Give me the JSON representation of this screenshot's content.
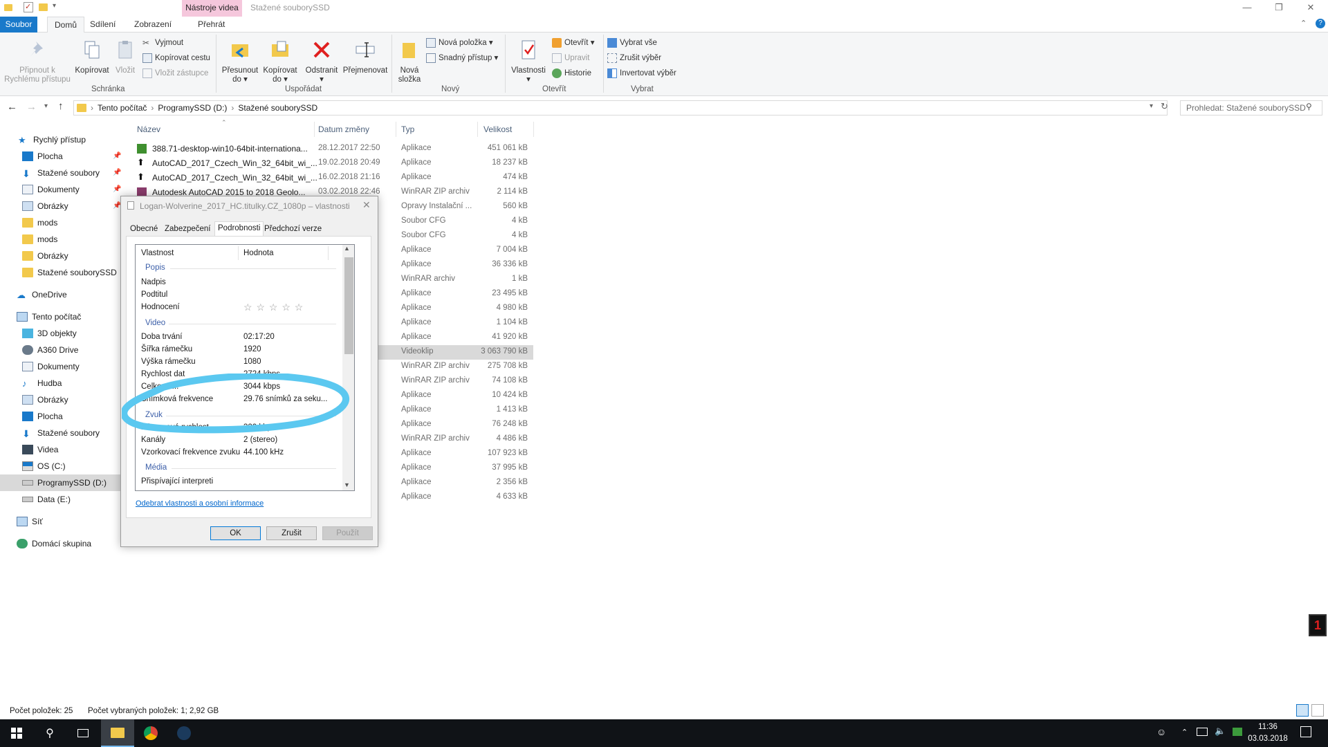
{
  "titlebar": {
    "context_tab": "Nástroje videa",
    "title": "Stažené souborySSD",
    "minimize": "—",
    "restore": "❐",
    "close": "✕"
  },
  "ribbon_tabs": {
    "soubor": "Soubor",
    "domu": "Domů",
    "sdileni": "Sdílení",
    "zobrazeni": "Zobrazení",
    "prehrat": "Přehrát"
  },
  "ribbon": {
    "pin_l1": "Připnout k",
    "pin_l2": "Rychlému přístupu",
    "copy": "Kopírovat",
    "paste": "Vložit",
    "cut": "Vyjmout",
    "copy_path": "Kopírovat cestu",
    "paste_shortcut": "Vložit zástupce",
    "group_clipboard": "Schránka",
    "move_l1": "Přesunout",
    "move_l2": "do ▾",
    "copyto_l1": "Kopírovat",
    "copyto_l2": "do ▾",
    "delete_l1": "Odstranit",
    "delete_l2": "▾",
    "rename": "Přejmenovat",
    "group_organize": "Uspořádat",
    "newfolder_l1": "Nová",
    "newfolder_l2": "složka",
    "new_item": "Nová položka ▾",
    "easy_access": "Snadný přístup ▾",
    "group_new": "Nový",
    "properties_l1": "Vlastnosti",
    "properties_l2": "▾",
    "open": "Otevřít ▾",
    "edit": "Upravit",
    "history": "Historie",
    "group_open": "Otevřít",
    "select_all": "Vybrat vše",
    "select_none": "Zrušit výběr",
    "invert": "Invertovat výběr",
    "group_select": "Vybrat"
  },
  "address": {
    "crumb1": "Tento počítač",
    "crumb2": "ProgramySSD (D:)",
    "crumb3": "Stažené souborySSD",
    "search_placeholder": "Prohledat: Stažené souborySSD"
  },
  "nav": {
    "quick": "Rychlý přístup",
    "plocha": "Plocha",
    "stazene": "Stažené soubory",
    "dokumenty": "Dokumenty",
    "obrazky": "Obrázky",
    "mods1": "mods",
    "mods2": "mods",
    "obrazky2": "Obrázky",
    "stazenessd": "Stažené souborySSD",
    "onedrive": "OneDrive",
    "pc": "Tento počítač",
    "objekty": "3D objekty",
    "a360": "A360 Drive",
    "dokumenty2": "Dokumenty",
    "hudba": "Hudba",
    "obrazky3": "Obrázky",
    "plocha2": "Plocha",
    "stazene2": "Stažené soubory",
    "videa": "Videa",
    "osc": "OS (C:)",
    "programy": "ProgramySSD (D:)",
    "datae": "Data (E:)",
    "sit": "Síť",
    "domaci": "Domácí skupina"
  },
  "columns": {
    "name": "Název",
    "date": "Datum změny",
    "type": "Typ",
    "size": "Velikost"
  },
  "files": [
    {
      "name": "388.71-desktop-win10-64bit-internationa...",
      "date": "28.12.2017 22:50",
      "type": "Aplikace",
      "size": "451 061 kB"
    },
    {
      "name": "AutoCAD_2017_Czech_Win_32_64bit_wi_...",
      "date": "19.02.2018 20:49",
      "type": "Aplikace",
      "size": "18 237 kB"
    },
    {
      "name": "AutoCAD_2017_Czech_Win_32_64bit_wi_...",
      "date": "16.02.2018 21:16",
      "type": "Aplikace",
      "size": "474 kB"
    },
    {
      "name": "Autodesk AutoCAD 2015 to 2018 Geolo...",
      "date": "03.02.2018 22:46",
      "type": "WinRAR ZIP archiv",
      "size": "2 114 kB"
    },
    {
      "name": "",
      "date": "",
      "type": "Opravy Instalační ...",
      "size": "560 kB"
    },
    {
      "name": "",
      "date": "",
      "type": "Soubor CFG",
      "size": "4 kB"
    },
    {
      "name": "",
      "date": "",
      "type": "Soubor CFG",
      "size": "4 kB"
    },
    {
      "name": "",
      "date": "",
      "type": "Aplikace",
      "size": "7 004 kB"
    },
    {
      "name": "",
      "date": "",
      "type": "Aplikace",
      "size": "36 336 kB"
    },
    {
      "name": "",
      "date": "",
      "type": "WinRAR archiv",
      "size": "1 kB"
    },
    {
      "name": "",
      "date": "",
      "type": "Aplikace",
      "size": "23 495 kB"
    },
    {
      "name": "",
      "date": "",
      "type": "Aplikace",
      "size": "4 980 kB"
    },
    {
      "name": "",
      "date": "",
      "type": "Aplikace",
      "size": "1 104 kB"
    },
    {
      "name": "",
      "date": "",
      "type": "Aplikace",
      "size": "41 920 kB"
    },
    {
      "name": "",
      "date": "",
      "type": "Videoklip",
      "size": "3 063 790 kB"
    },
    {
      "name": "",
      "date": "",
      "type": "WinRAR ZIP archiv",
      "size": "275 708 kB"
    },
    {
      "name": "",
      "date": "",
      "type": "WinRAR ZIP archiv",
      "size": "74 108 kB"
    },
    {
      "name": "",
      "date": "",
      "type": "Aplikace",
      "size": "10 424 kB"
    },
    {
      "name": "",
      "date": "",
      "type": "Aplikace",
      "size": "1 413 kB"
    },
    {
      "name": "",
      "date": "",
      "type": "Aplikace",
      "size": "76 248 kB"
    },
    {
      "name": "",
      "date": "",
      "type": "WinRAR ZIP archiv",
      "size": "4 486 kB"
    },
    {
      "name": "",
      "date": "",
      "type": "Aplikace",
      "size": "107 923 kB"
    },
    {
      "name": "",
      "date": "",
      "type": "Aplikace",
      "size": "37 995 kB"
    },
    {
      "name": "",
      "date": "",
      "type": "Aplikace",
      "size": "2 356 kB"
    },
    {
      "name": "",
      "date": "",
      "type": "Aplikace",
      "size": "4 633 kB"
    }
  ],
  "dialog": {
    "title": "Logan-Wolverine_2017_HC.titulky.CZ_1080p – vlastnosti",
    "tabs": {
      "obecne": "Obecné",
      "zabezpeceni": "Zabezpečení",
      "podrobnosti": "Podrobnosti",
      "predchozi": "Předchozí verze"
    },
    "col_prop": "Vlastnost",
    "col_val": "Hodnota",
    "sec_popis": "Popis",
    "nadpis": "Nadpis",
    "podtitul": "Podtitul",
    "hodnoceni": "Hodnocení",
    "stars": "☆ ☆ ☆ ☆ ☆",
    "sec_video": "Video",
    "doba": "Doba trvání",
    "doba_v": "02:17:20",
    "sirka": "Šířka rámečku",
    "sirka_v": "1920",
    "vyska": "Výška rámečku",
    "vyska_v": "1080",
    "rychlost": "Rychlost dat",
    "rychlost_v": "2724 kbps",
    "celkova": "Celková ...",
    "celkova_v": "3044 kbps",
    "snimkova": "Snímková frekvence",
    "snimkova_v": "29.76 snímků za seku...",
    "sec_zvuk": "Zvuk",
    "bitova": "Přenosová rychlost",
    "bitova_v": "320 kbps",
    "kanaly": "Kanály",
    "kanaly_v": "2 (stereo)",
    "vzorkovaci": "Vzorkovací frekvence zvuku",
    "vzorkovaci_v": "44.100 kHz",
    "sec_media": "Média",
    "prispivajici": "Přispívající interpreti",
    "remove_link": "Odebrat vlastnosti a osobní informace",
    "ok": "OK",
    "cancel": "Zrušit",
    "apply": "Použít"
  },
  "status": {
    "count": "Počet položek: 25",
    "selected": "Počet vybraných položek: 1; 2,92 GB"
  },
  "taskbar": {
    "time": "11:36",
    "date": "03.03.2018"
  },
  "colors": {
    "accent": "#1979ca",
    "highlight": "#5bc8f0",
    "taskbar": "#101317"
  }
}
